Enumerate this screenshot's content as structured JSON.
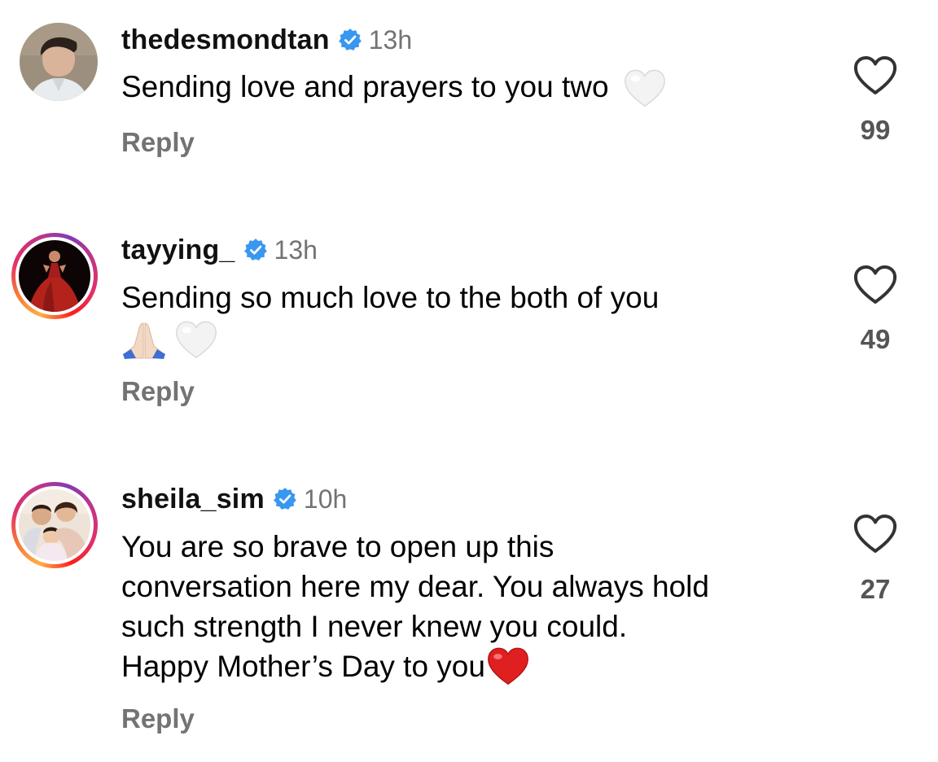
{
  "comments": [
    {
      "username": "thedesmondtan",
      "time": "13h",
      "text": "Sending love and prayers to you two",
      "emoji": [
        "white-heart"
      ],
      "reply_label": "Reply",
      "likes": "99",
      "avatar_ring": false
    },
    {
      "username": "tayying_",
      "time": "13h",
      "text": "Sending so much love to the both of you",
      "emoji": [
        "folded-hands",
        "white-heart"
      ],
      "reply_label": "Reply",
      "likes": "49",
      "avatar_ring": true
    },
    {
      "username": "sheila_sim",
      "time": "10h",
      "text_lines": [
        "You are so brave to open up this",
        "conversation here my dear. You always hold",
        "such strength I never knew you could.",
        "Happy Mother’s Day to you"
      ],
      "emoji": [
        "red-heart"
      ],
      "reply_label": "Reply",
      "likes": "27",
      "avatar_ring": true
    }
  ],
  "colors": {
    "verified_blue": "#3897f0",
    "muted_text": "#737373",
    "red_heart": "#e02020"
  }
}
